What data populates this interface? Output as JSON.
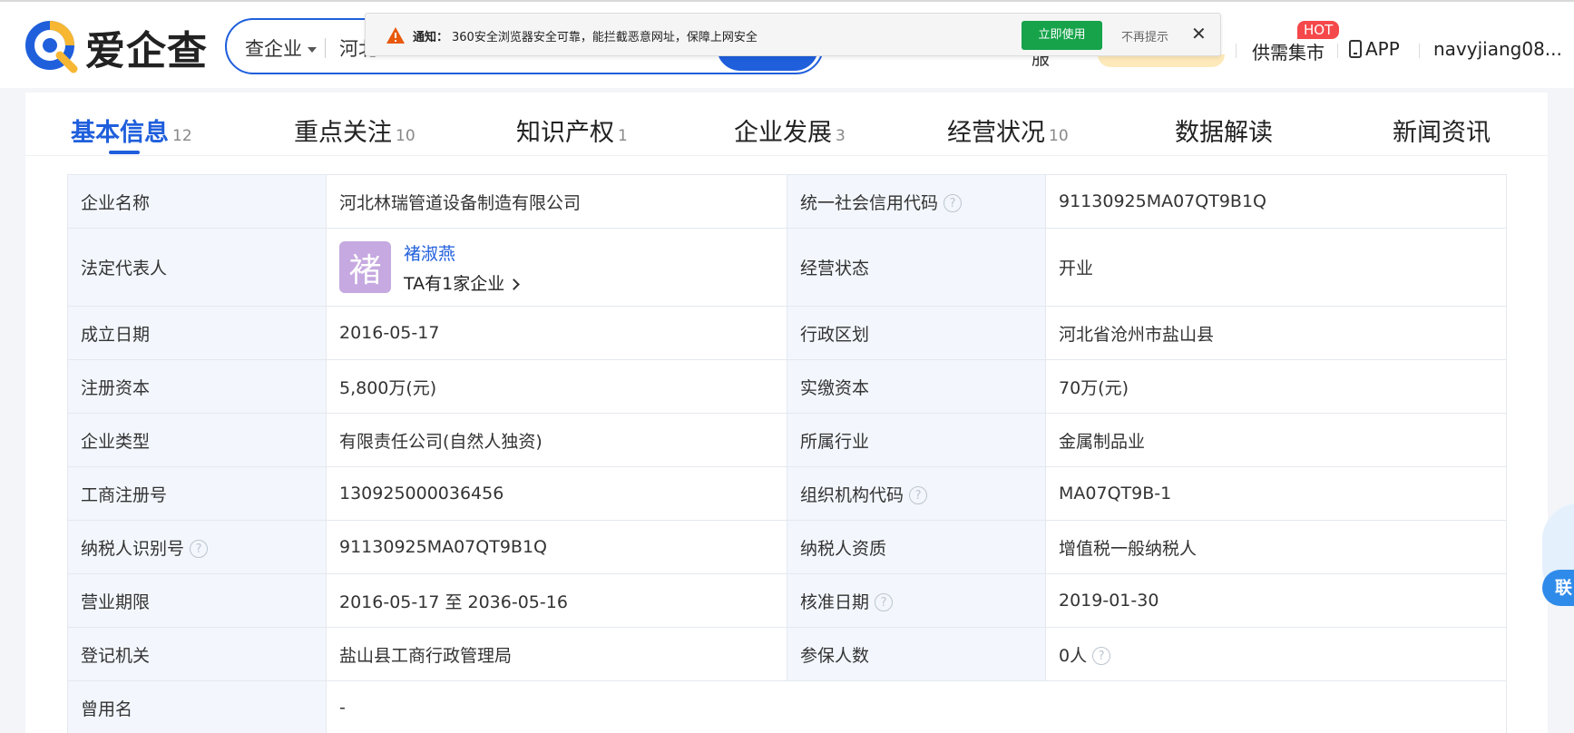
{
  "header": {
    "logo_text": "爱企查",
    "search_type": "查企业",
    "search_value": "河北",
    "partial_text": "服",
    "supply_label": "供需集市",
    "hot_badge": "HOT",
    "app_label": "APP",
    "user_name": "navyjiang08..."
  },
  "notification": {
    "label": "通知：",
    "text": "360安全浏览器安全可靠，能拦截恶意网址，保障上网安全",
    "use_button": "立即使用",
    "dismiss": "不再提示",
    "close": "✕"
  },
  "tabs": [
    {
      "label": "基本信息",
      "count": "12"
    },
    {
      "label": "重点关注",
      "count": "10"
    },
    {
      "label": "知识产权",
      "count": "1"
    },
    {
      "label": "企业发展",
      "count": "3"
    },
    {
      "label": "经营状况",
      "count": "10"
    },
    {
      "label": "数据解读",
      "count": ""
    },
    {
      "label": "新闻资讯",
      "count": ""
    }
  ],
  "info": {
    "company_name_label": "企业名称",
    "company_name": "河北林瑞管道设备制造有限公司",
    "credit_code_label": "统一社会信用代码",
    "credit_code": "91130925MA07QT9B1Q",
    "legal_rep_label": "法定代表人",
    "legal_rep_avatar": "褚",
    "legal_rep_name": "褚淑燕",
    "legal_rep_sub": "TA有1家企业",
    "status_label": "经营状态",
    "status": "开业",
    "founded_label": "成立日期",
    "founded": "2016-05-17",
    "region_label": "行政区划",
    "region": "河北省沧州市盐山县",
    "reg_capital_label": "注册资本",
    "reg_capital": "5,800万(元)",
    "paid_capital_label": "实缴资本",
    "paid_capital": "70万(元)",
    "type_label": "企业类型",
    "type": "有限责任公司(自然人独资)",
    "industry_label": "所属行业",
    "industry": "金属制品业",
    "biz_reg_no_label": "工商注册号",
    "biz_reg_no": "130925000036456",
    "org_code_label": "组织机构代码",
    "org_code": "MA07QT9B-1",
    "taxpayer_id_label": "纳税人识别号",
    "taxpayer_id": "91130925MA07QT9B1Q",
    "taxpayer_qual_label": "纳税人资质",
    "taxpayer_qual": "增值税一般纳税人",
    "term_label": "营业期限",
    "term": "2016-05-17 至 2036-05-16",
    "approval_date_label": "核准日期",
    "approval_date": "2019-01-30",
    "authority_label": "登记机关",
    "authority": "盐山县工商行政管理局",
    "insured_label": "参保人数",
    "insured": "0人",
    "former_name_label": "曾用名",
    "former_name": "-"
  },
  "float_widget": {
    "label": "联"
  },
  "colors": {
    "brand_blue": "#1f5fdc",
    "notify_green": "#16a34a",
    "hot_red": "#f5484a",
    "avatar_purple": "#c6a9e0"
  }
}
